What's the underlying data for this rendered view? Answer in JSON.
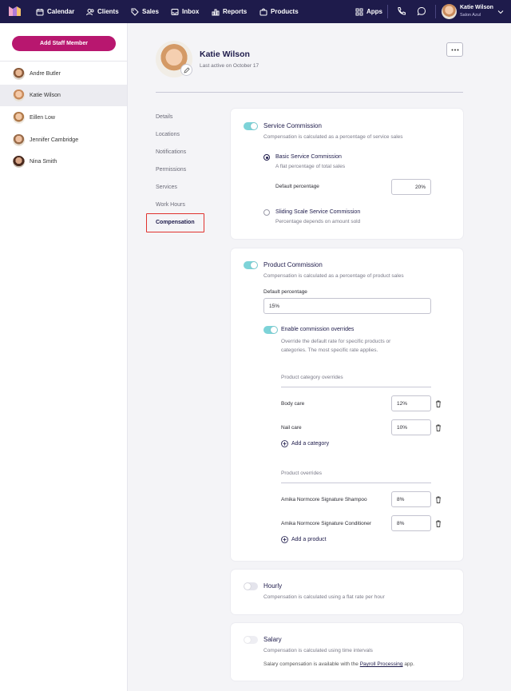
{
  "nav": {
    "items": [
      {
        "label": "Calendar",
        "icon": "calendar-icon"
      },
      {
        "label": "Clients",
        "icon": "users-icon"
      },
      {
        "label": "Sales",
        "icon": "tag-icon"
      },
      {
        "label": "Inbox",
        "icon": "inbox-icon"
      },
      {
        "label": "Reports",
        "icon": "bar-chart-icon"
      },
      {
        "label": "Products",
        "icon": "bag-icon"
      }
    ],
    "apps_label": "Apps",
    "user_name": "Katie Wilson",
    "user_sub": "Salon Azul"
  },
  "sidebar": {
    "add_button": "Add Staff Member",
    "staff": [
      "Andre Butler",
      "Katie Wilson",
      "Eillen Low",
      "Jennifer Cambridge",
      "Nina Smith"
    ],
    "active_index": 1
  },
  "profile": {
    "name": "Katie Wilson",
    "last_active": "Last active on October 17"
  },
  "tabs": [
    "Details",
    "Locations",
    "Notifications",
    "Permissions",
    "Services",
    "Work Hours",
    "Compensation"
  ],
  "service": {
    "title": "Service Commission",
    "sub": "Compensation is calculated as a percentage of service sales",
    "basic_title": "Basic Service Commission",
    "basic_sub": "A flat percentage of total sales",
    "default_label": "Default percentage",
    "default_value": "20%",
    "sliding_title": "Sliding Scale Service Commission",
    "sliding_sub": "Percentage depends on amount sold"
  },
  "product": {
    "title": "Product Commission",
    "sub": "Compensation is calculated as a percentage of product sales",
    "default_label": "Default percentage",
    "default_value": "15%",
    "override_title": "Enable commission overrides",
    "override_sub_1": "Override the default rate for specific products or",
    "override_sub_2": "categories. The most specific rate applies.",
    "category_header": "Product category overrides",
    "categories": [
      {
        "name": "Body care",
        "value": "12%"
      },
      {
        "name": "Nail care",
        "value": "10%"
      }
    ],
    "add_category": "Add a category",
    "product_header": "Product overrides",
    "products": [
      {
        "name": "Amika Normcore Signature Shampoo",
        "value": "8%"
      },
      {
        "name": "Amika Normcore Signature Conditioner",
        "value": "8%"
      }
    ],
    "add_product": "Add a product"
  },
  "hourly": {
    "title": "Hourly",
    "sub": "Compensation is calculated using a flat rate per hour"
  },
  "salary": {
    "title": "Salary",
    "sub": "Compensation is calculated using time intervals",
    "note_prefix": "Salary compensation is available with the ",
    "note_link": "Payroll Processing",
    "note_suffix": " app."
  },
  "colors": {
    "nav_bg": "#1e1b4b",
    "brand": "#b8176f",
    "toggle_on": "#7dd3d8",
    "highlight": "#e0322e"
  }
}
